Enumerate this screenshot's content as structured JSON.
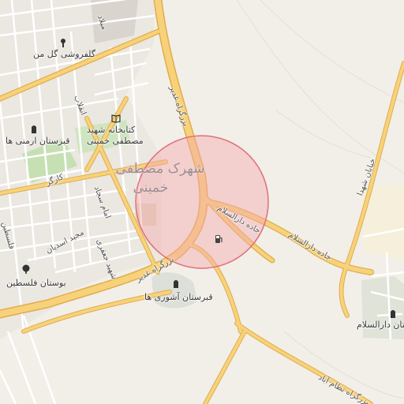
{
  "map": {
    "labels": {
      "golforooshi": "گلفروشی گل من",
      "ketabkhaneh_l1": "کتابخانه شهید",
      "ketabkhaneh_l2": "مصطفی خمینی",
      "ghabrestan_armani": "قبرستان ارمنی ها",
      "shahrak_l1": "شهرک مصطفی",
      "shahrak_l2": "خمینی",
      "ghabrestan_ashoori": "قبرستان آشوری ها",
      "bustan_felestin": "بوستان فلسطین",
      "bustan_darolsalam": "بوستان دارالسلام"
    },
    "streets": {
      "milad": "میلاد",
      "bozorgrah_ghadir_north": "بزرگراه غدیر",
      "bozorgrah_ghadir_south": "بزرگراه غدیر",
      "enghelab": "انقلاب",
      "kargar": "کارگر",
      "felestin": "فلسطین",
      "emam_sajjad": "امام سجاد",
      "masjed_asadian": "مجید اسدیان",
      "shahid_jafari": "شهید جعفری",
      "jadeh_darolsalam_a": "جاده دارالسلام",
      "jadeh_darolsalam_b": "جاده دارالسلام",
      "khiaban_shohada": "خیابان شهدا",
      "nezamabad": "بزرگراه نظام آباد"
    },
    "icons": {
      "florist": "flower-shop-icon",
      "library": "book-icon",
      "cemetery_armenian": "cemetery-icon",
      "cemetery_assyrian": "cemetery-icon",
      "park_felestin": "tree-icon",
      "park_darolsalam": "cemetery-icon",
      "fuel": "fuel-icon"
    },
    "colors": {
      "background": "#f2efe9",
      "road_major": "#f6cd6e",
      "road_casing": "#e3b04f",
      "road_minor": "#ffffff",
      "block": "#e7e3de",
      "park": "#c6e0b4",
      "highlight_fill": "#f4a8ae",
      "highlight_stroke": "#e07078"
    }
  }
}
